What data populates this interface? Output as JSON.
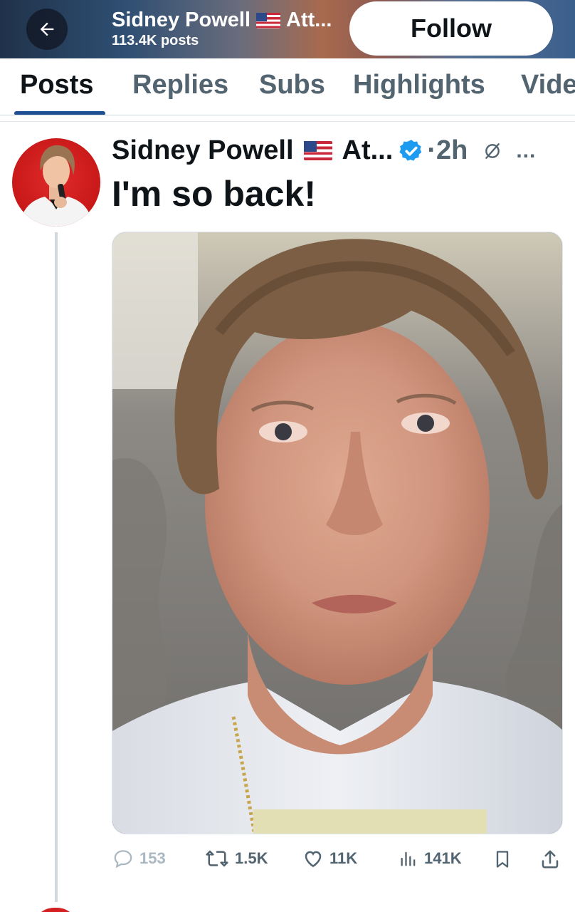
{
  "header": {
    "name": "Sidney Powell",
    "affiliation_truncated": "Att...",
    "post_count": "113.4K posts",
    "follow_label": "Follow"
  },
  "tabs": [
    {
      "label": "Posts",
      "active": true
    },
    {
      "label": "Replies",
      "active": false
    },
    {
      "label": "Subs",
      "active": false
    },
    {
      "label": "Highlights",
      "active": false
    },
    {
      "label": "Vide",
      "active": false
    }
  ],
  "post": {
    "author_name": "Sidney Powell",
    "affiliation_truncated": "At...",
    "time": "·2h",
    "text": "I'm so back!",
    "more_icon": "...",
    "actions": {
      "replies": "153",
      "reposts": "1.5K",
      "likes": "11K",
      "views": "141K"
    }
  },
  "colors": {
    "verified_blue": "#1d9bf0",
    "tab_indicator": "#1d4f91",
    "secondary_text": "#536471"
  },
  "icons": [
    "back-arrow-icon",
    "flag-us-icon",
    "verified-badge-icon",
    "grok-icon",
    "more-icon",
    "reply-icon",
    "repost-icon",
    "like-icon",
    "views-icon",
    "bookmark-icon",
    "share-icon"
  ]
}
